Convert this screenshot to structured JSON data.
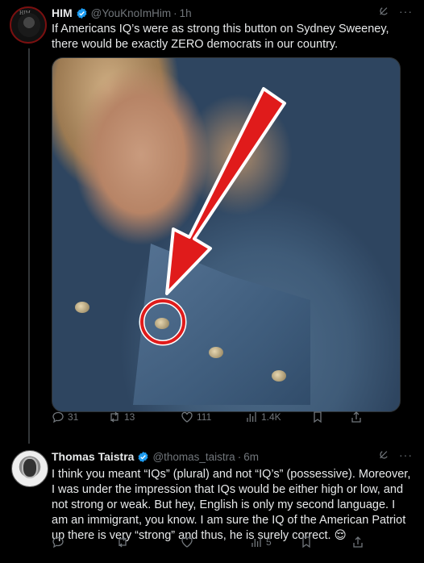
{
  "tweets": [
    {
      "author": {
        "name": "HIM",
        "handle": "@YouKnoImHim",
        "time": "1h",
        "avatar_label": "HIM"
      },
      "text": "If Americans IQ’s were as strong this button on Sydney Sweeney, there would be exactly ZERO democrats in our country.",
      "media": {
        "description_icons": [
          "red-arrow",
          "red-circle"
        ]
      },
      "actions": {
        "replies": "31",
        "retweets": "13",
        "likes": "111",
        "views": "1.4K"
      }
    },
    {
      "author": {
        "name": "Thomas Taistra",
        "handle": "@thomas_taistra",
        "time": "6m"
      },
      "text": "I think you meant “IQs” (plural) and not “IQ’s” (possessive). Moreover, I was under the impression that IQs would be either high or low, and not strong or weak. But hey, English is only my second language. I am an immigrant, you know. I am sure the IQ of the American Patriot up there is very “strong” and thus, he is surely correct. 😌",
      "actions": {
        "replies": "",
        "retweets": "",
        "likes": "",
        "views": "5"
      }
    }
  ],
  "colors": {
    "verified": "#1d9bf0",
    "muted": "#71767b",
    "annotation_red": "#e01b1b"
  }
}
